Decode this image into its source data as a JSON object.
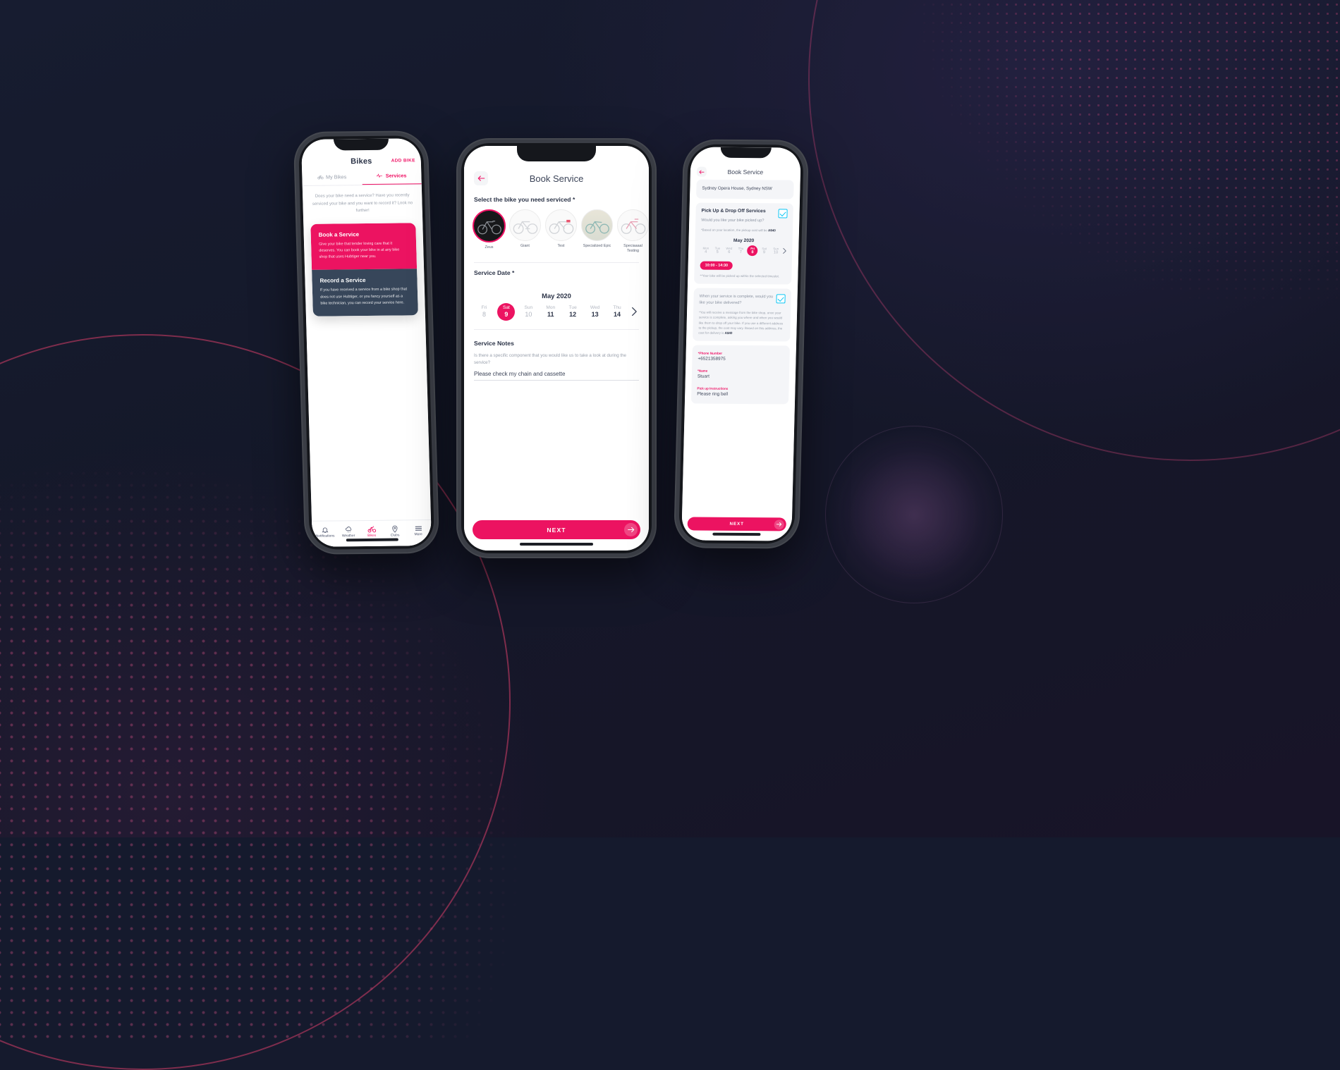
{
  "background": {
    "base_color": "#151a2d",
    "accent_color": "#ec1361"
  },
  "phone1": {
    "header": {
      "title": "Bikes",
      "add_bike_label": "ADD BIKE"
    },
    "tabs": [
      {
        "label": "My Bikes",
        "icon": "bicycle-icon",
        "active": false
      },
      {
        "label": "Services",
        "icon": "pulse-icon",
        "active": true
      }
    ],
    "intro": "Does your bike need a service? Have you recently serviced your bike and you want to record it? Look no further!",
    "cards": [
      {
        "title": "Book a Service",
        "body": "Give your bike that tender loving care that it deserves. You can book your bike in at any bike shop that uses Hubtiger near you.",
        "color": "#ec1361"
      },
      {
        "title": "Record a Service",
        "body": "If you have received a service from a bike shop that does not use Hubtiger, or you fancy yourself as a bike technician, you can record your service here.",
        "color": "#37465a"
      }
    ],
    "nav": [
      {
        "label": "Notifications",
        "icon": "bell-icon",
        "active": false
      },
      {
        "label": "Weather",
        "icon": "cloud-rain-icon",
        "active": false
      },
      {
        "label": "Bikes",
        "icon": "bicycle-icon",
        "active": true
      },
      {
        "label": "Clubs",
        "icon": "location-pin-icon",
        "active": false
      },
      {
        "label": "More",
        "icon": "hamburger-icon",
        "active": false
      }
    ]
  },
  "phone2": {
    "header": {
      "title": "Book Service",
      "back_icon": "arrow-left-icon"
    },
    "bike_section_label": "Select the bike you need serviced *",
    "bikes": [
      {
        "name": "Zeus",
        "selected": true
      },
      {
        "name": "Giant",
        "selected": false
      },
      {
        "name": "Test",
        "selected": false
      },
      {
        "name": "Specialized Epic",
        "selected": false
      },
      {
        "name": "Speciaaaal Testing",
        "selected": false
      }
    ],
    "date_section_label": "Service Date *",
    "month": "May 2020",
    "days": [
      {
        "dow": "Fri",
        "num": "8",
        "state": "past"
      },
      {
        "dow": "Sat",
        "num": "9",
        "state": "selected"
      },
      {
        "dow": "Sun",
        "num": "10",
        "state": "disabled"
      },
      {
        "dow": "Mon",
        "num": "11",
        "state": "available"
      },
      {
        "dow": "Tue",
        "num": "12",
        "state": "available"
      },
      {
        "dow": "Wed",
        "num": "13",
        "state": "available"
      },
      {
        "dow": "Thu",
        "num": "14",
        "state": "available"
      }
    ],
    "next_day_icon": "chevron-right-icon",
    "notes": {
      "heading": "Service Notes",
      "question": "Is there a specific component that you would like us to take a look at during the service?",
      "value": "Please check my chain and cassette"
    },
    "next_button": {
      "label": "NEXT",
      "icon": "arrow-right-icon"
    }
  },
  "phone3": {
    "header": {
      "title": "Book Service",
      "back_icon": "arrow-left-icon"
    },
    "address": "Sydney Opera House, Sydney NSW",
    "pickup": {
      "heading": "Pick Up & Drop Off Services",
      "question": "Would you like your bike picked up?",
      "note_prefix": "*Based on your location, the pickup cost will be ",
      "note_price": "A$40",
      "checked": true,
      "month": "May 2020",
      "days": [
        {
          "dow": "Mon",
          "num": "4",
          "state": "disabled"
        },
        {
          "dow": "Tue",
          "num": "5",
          "state": "disabled"
        },
        {
          "dow": "Wed",
          "num": "6",
          "state": "disabled"
        },
        {
          "dow": "Thu",
          "num": "7",
          "state": "disabled"
        },
        {
          "dow": "Fri",
          "num": "8",
          "state": "selected"
        },
        {
          "dow": "Sat",
          "num": "9",
          "state": "disabled"
        },
        {
          "dow": "Sun",
          "num": "10",
          "state": "disabled"
        }
      ],
      "next_day_icon": "chevron-right-icon",
      "timeslot": "10:00 - 14:30",
      "timeslot_note": "**Your bike will be picked up within the selected timeslot."
    },
    "delivery": {
      "question": "When your service is complete, would you like your bike delivered?",
      "note_prefix": "*You will receive a message from the bike shop, once your service is complete, asking you where and when you would like them to drop off your bike. If you use a different address to the pickup, the cost may vary. Based on this address, the cost for delivery is ",
      "note_price": "A$40",
      "checked": true
    },
    "fields": [
      {
        "label": "*Phone Number",
        "value": "+6521358975"
      },
      {
        "label": "*Name",
        "value": "Stuart"
      },
      {
        "label": "Pick up Instructions",
        "value": "Please ring bell"
      }
    ],
    "next_button": {
      "label": "NEXT",
      "icon": "arrow-right-icon"
    }
  }
}
